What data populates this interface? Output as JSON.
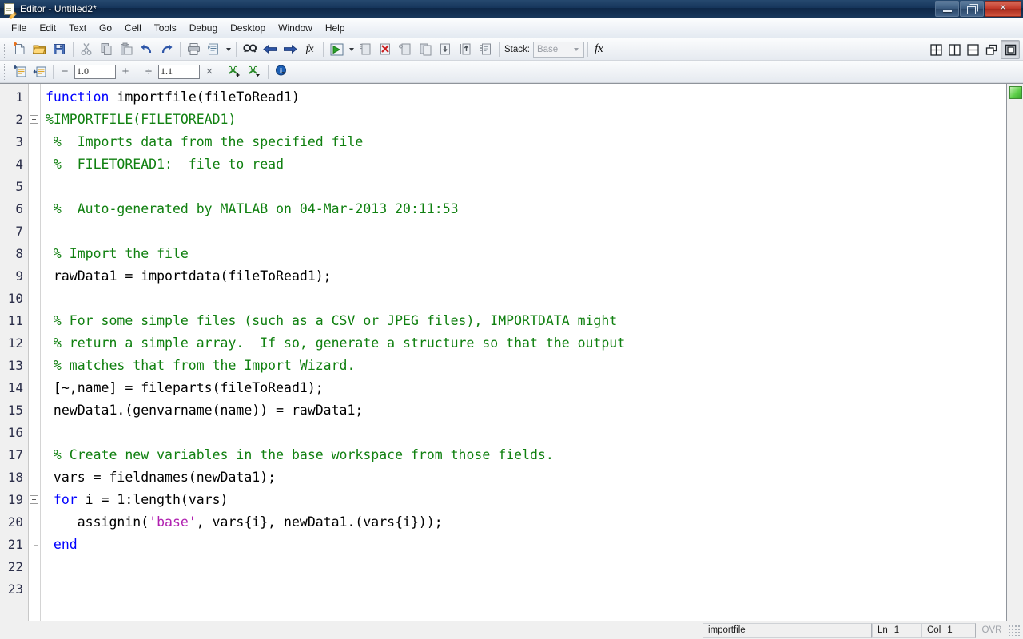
{
  "window": {
    "title": "Editor - Untitled2*",
    "icon": "editor-document-pencil-icon",
    "buttons": {
      "minimize": "minimize",
      "restore": "restore",
      "close": "close"
    }
  },
  "menubar": {
    "items": [
      {
        "label": "File"
      },
      {
        "label": "Edit"
      },
      {
        "label": "Text"
      },
      {
        "label": "Go"
      },
      {
        "label": "Cell"
      },
      {
        "label": "Tools"
      },
      {
        "label": "Debug"
      },
      {
        "label": "Desktop"
      },
      {
        "label": "Window"
      },
      {
        "label": "Help"
      }
    ]
  },
  "toolbar_main": {
    "stack_label": "Stack:",
    "stack_value": "Base",
    "fx_label": "fx",
    "buttons": [
      {
        "name": "new-file-icon",
        "tip": "New"
      },
      {
        "name": "open-file-icon",
        "tip": "Open"
      },
      {
        "name": "save-icon",
        "tip": "Save"
      },
      {
        "name": "cut-icon",
        "tip": "Cut"
      },
      {
        "name": "copy-icon",
        "tip": "Copy"
      },
      {
        "name": "paste-icon",
        "tip": "Paste"
      },
      {
        "name": "undo-icon",
        "tip": "Undo"
      },
      {
        "name": "redo-icon",
        "tip": "Redo"
      },
      {
        "name": "print-icon",
        "tip": "Print"
      },
      {
        "name": "publish-icon",
        "tip": "Publish"
      },
      {
        "name": "find-icon",
        "tip": "Find"
      },
      {
        "name": "back-icon",
        "tip": "Back"
      },
      {
        "name": "forward-icon",
        "tip": "Forward"
      },
      {
        "name": "function-browser-icon",
        "tip": "Function Browser"
      },
      {
        "name": "run-icon",
        "tip": "Run"
      },
      {
        "name": "stop-debug-icon",
        "tip": "Exit Debug Mode"
      },
      {
        "name": "clear-breakpoints-icon",
        "tip": "Clear Breakpoints"
      },
      {
        "name": "set-breakpoint-icon",
        "tip": "Set/Clear Breakpoint"
      },
      {
        "name": "step-icon",
        "tip": "Step"
      },
      {
        "name": "step-in-icon",
        "tip": "Step In"
      },
      {
        "name": "step-out-icon",
        "tip": "Step Out"
      },
      {
        "name": "continue-icon",
        "tip": "Continue"
      }
    ],
    "layout_buttons": [
      {
        "name": "tile-grid-icon"
      },
      {
        "name": "split-vertical-icon"
      },
      {
        "name": "split-horizontal-icon"
      },
      {
        "name": "float-window-icon"
      },
      {
        "name": "maximize-pane-icon"
      }
    ]
  },
  "toolbar_cell": {
    "increment_value": "1.0",
    "divide_value": "1.1",
    "minus": "−",
    "plus": "+",
    "divide": "÷",
    "times": "×",
    "buttons": [
      {
        "name": "insert-cell-icon"
      },
      {
        "name": "insert-cell-divider-icon"
      },
      {
        "name": "evaluate-cell-add-icon"
      },
      {
        "name": "evaluate-cell-advance-icon"
      },
      {
        "name": "cell-info-icon"
      }
    ]
  },
  "editor": {
    "filename": "importfile",
    "analyzer_status": "ok",
    "lines": [
      {
        "n": "1",
        "fold": "open",
        "tokens": [
          {
            "t": "kw",
            "s": "function"
          },
          {
            "t": "plain",
            "s": " importfile(fileToRead1)"
          }
        ]
      },
      {
        "n": "2",
        "fold": "open",
        "tokens": [
          {
            "t": "cmt",
            "s": "%IMPORTFILE(FILETOREAD1)"
          }
        ]
      },
      {
        "n": "3",
        "fold": "bar",
        "tokens": [
          {
            "t": "cmt",
            "s": " %  Imports data from the specified file"
          }
        ]
      },
      {
        "n": "4",
        "fold": "end",
        "tokens": [
          {
            "t": "cmt",
            "s": " %  FILETOREAD1:  file to read"
          }
        ]
      },
      {
        "n": "5",
        "fold": "none",
        "tokens": [
          {
            "t": "plain",
            "s": ""
          }
        ]
      },
      {
        "n": "6",
        "fold": "none",
        "tokens": [
          {
            "t": "cmt",
            "s": " %  Auto-generated by MATLAB on 04-Mar-2013 20:11:53"
          }
        ]
      },
      {
        "n": "7",
        "fold": "none",
        "tokens": [
          {
            "t": "plain",
            "s": ""
          }
        ]
      },
      {
        "n": "8",
        "fold": "none",
        "tokens": [
          {
            "t": "cmt",
            "s": " % Import the file"
          }
        ]
      },
      {
        "n": "9",
        "fold": "none",
        "tokens": [
          {
            "t": "plain",
            "s": " rawData1 = importdata(fileToRead1);"
          }
        ]
      },
      {
        "n": "10",
        "fold": "none",
        "tokens": [
          {
            "t": "plain",
            "s": ""
          }
        ]
      },
      {
        "n": "11",
        "fold": "none",
        "tokens": [
          {
            "t": "cmt",
            "s": " % For some simple files (such as a CSV or JPEG files), IMPORTDATA might"
          }
        ]
      },
      {
        "n": "12",
        "fold": "none",
        "tokens": [
          {
            "t": "cmt",
            "s": " % return a simple array.  If so, generate a structure so that the output"
          }
        ]
      },
      {
        "n": "13",
        "fold": "none",
        "tokens": [
          {
            "t": "cmt",
            "s": " % matches that from the Import Wizard."
          }
        ]
      },
      {
        "n": "14",
        "fold": "none",
        "tokens": [
          {
            "t": "plain",
            "s": " [~,name] = fileparts(fileToRead1);"
          }
        ]
      },
      {
        "n": "15",
        "fold": "none",
        "tokens": [
          {
            "t": "plain",
            "s": " newData1.(genvarname(name)) = rawData1;"
          }
        ]
      },
      {
        "n": "16",
        "fold": "none",
        "tokens": [
          {
            "t": "plain",
            "s": ""
          }
        ]
      },
      {
        "n": "17",
        "fold": "none",
        "tokens": [
          {
            "t": "cmt",
            "s": " % Create new variables in the base workspace from those fields."
          }
        ]
      },
      {
        "n": "18",
        "fold": "none",
        "tokens": [
          {
            "t": "plain",
            "s": " vars = fieldnames(newData1);"
          }
        ]
      },
      {
        "n": "19",
        "fold": "open",
        "tokens": [
          {
            "t": "kw",
            "s": " for"
          },
          {
            "t": "plain",
            "s": " i = 1:length(vars)"
          }
        ]
      },
      {
        "n": "20",
        "fold": "bar",
        "tokens": [
          {
            "t": "plain",
            "s": "    assignin("
          },
          {
            "t": "str",
            "s": "'base'"
          },
          {
            "t": "plain",
            "s": ", vars{i}, newData1.(vars{i}));"
          }
        ]
      },
      {
        "n": "21",
        "fold": "end",
        "tokens": [
          {
            "t": "kw",
            "s": " end"
          }
        ]
      },
      {
        "n": "22",
        "fold": "none",
        "tokens": [
          {
            "t": "plain",
            "s": ""
          }
        ]
      },
      {
        "n": "23",
        "fold": "none",
        "tokens": [
          {
            "t": "plain",
            "s": ""
          }
        ]
      }
    ]
  },
  "statusbar": {
    "filename": "importfile",
    "line_label": "Ln",
    "line_value": "1",
    "col_label": "Col",
    "col_value": "1",
    "overwrite": "OVR"
  },
  "colors": {
    "keyword": "#0000ff",
    "comment": "#108010",
    "string": "#b020b0",
    "plain": "#000000",
    "analyzer_ok": "#3aa830",
    "titlebar": "#16355b"
  }
}
